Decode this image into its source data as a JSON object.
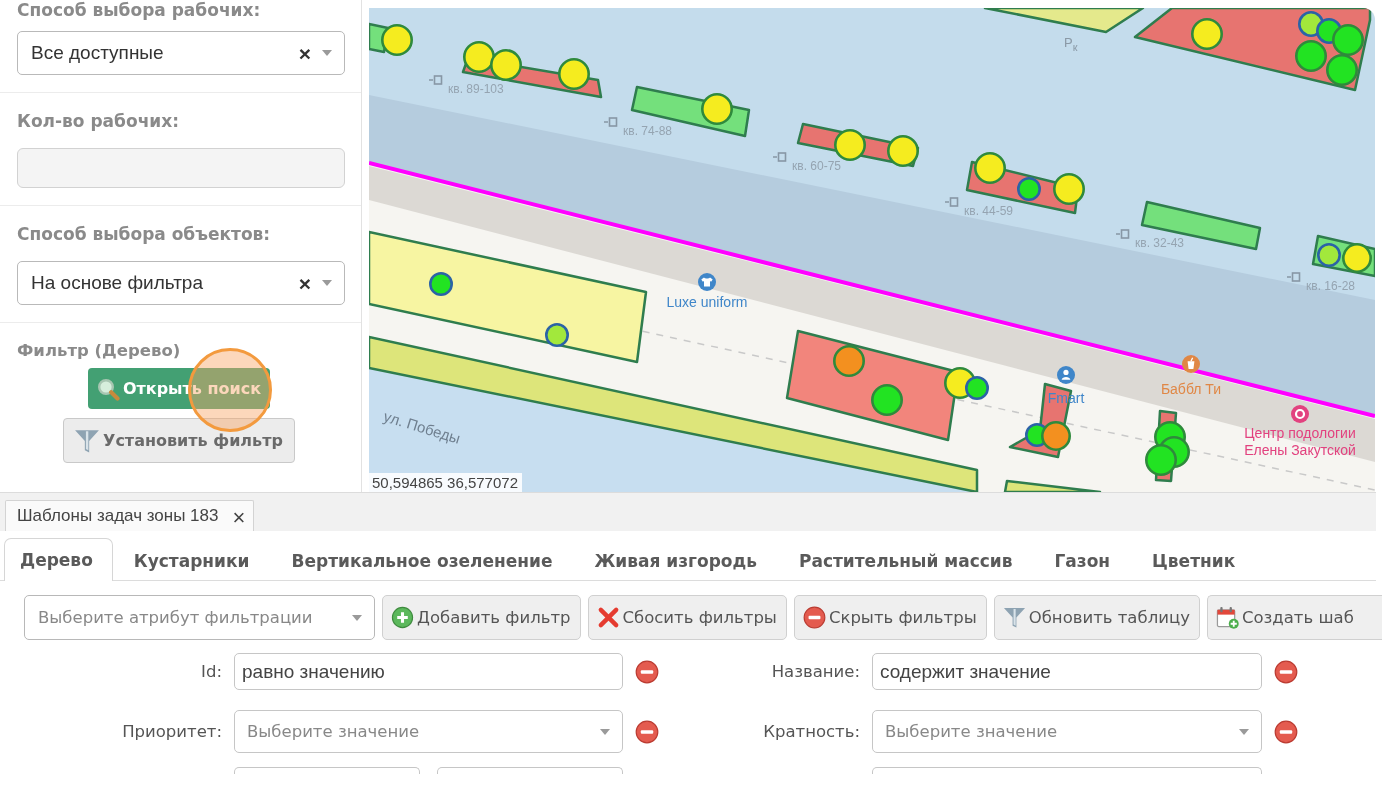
{
  "sidebar": {
    "sections": [
      {
        "label": "Способ выбора рабочих:",
        "kind": "select",
        "value": "Все доступные",
        "clear": "×"
      },
      {
        "label": "Кол-во рабочих:",
        "kind": "input"
      },
      {
        "label": "Способ выбора объектов:",
        "kind": "select",
        "value": "На основе фильтра",
        "clear": "×"
      },
      {
        "label": "Фильтр (Дерево)",
        "kind": "buttons",
        "buttons": [
          {
            "label": "Открыть поиск",
            "kind": "search"
          },
          {
            "label": "Установить фильтр",
            "kind": "filter"
          }
        ]
      }
    ]
  },
  "map": {
    "areas": [
      {
        "color": "#f7f5a2"
      },
      {
        "color": "#dde57a"
      },
      {
        "color": "#dde57a"
      },
      {
        "color": "#e4e98c"
      },
      {
        "color": "#74e07c"
      },
      {
        "color": "#e77470"
      },
      {
        "color": "#74e07c"
      },
      {
        "color": "#e77470"
      },
      {
        "color": "#e77470"
      },
      {
        "color": "#74e07c"
      },
      {
        "color": "#e77470"
      },
      {
        "color": "#74e07c"
      },
      {
        "color": "#f2857c"
      },
      {
        "color": "#e77470"
      },
      {
        "color": "#e77470"
      }
    ],
    "markers": [
      {
        "color": "#f5ec1f",
        "selected": false
      },
      {
        "color": "#f5ec1f",
        "selected": false
      },
      {
        "color": "#f5ec1f",
        "selected": false
      },
      {
        "color": "#f5ec1f",
        "selected": false
      },
      {
        "color": "#f5ec1f",
        "selected": false
      },
      {
        "color": "#f5ec1f",
        "selected": false
      },
      {
        "color": "#f5ec1f",
        "selected": false
      },
      {
        "color": "#f5ec1f",
        "selected": false
      },
      {
        "color": "#22e322",
        "selected": true
      },
      {
        "color": "#f5ec1f",
        "selected": false
      },
      {
        "color": "#f5ec1f",
        "selected": false
      },
      {
        "color": "#a2e83c",
        "selected": true
      },
      {
        "color": "#22e322",
        "selected": true
      },
      {
        "color": "#22e322",
        "selected": false
      },
      {
        "color": "#22e322",
        "selected": false
      },
      {
        "color": "#22e322",
        "selected": false
      },
      {
        "color": "#a2e83c",
        "selected": true
      },
      {
        "color": "#f5ec1f",
        "selected": false
      },
      {
        "color": "#22e322",
        "selected": true
      },
      {
        "color": "#a2e83c",
        "selected": true
      },
      {
        "color": "#f3901f",
        "selected": false
      },
      {
        "color": "#22e322",
        "selected": false
      },
      {
        "color": "#f5ec1f",
        "selected": false
      },
      {
        "color": "#22e322",
        "selected": true
      },
      {
        "color": "#22e322",
        "selected": true
      },
      {
        "color": "#f3901f",
        "selected": false
      },
      {
        "color": "#22e322",
        "selected": false
      },
      {
        "color": "#22e322",
        "selected": false
      },
      {
        "color": "#22e322",
        "selected": false
      }
    ],
    "labels": [
      {
        "kind": "house",
        "text": "кв. 89-103"
      },
      {
        "kind": "house",
        "text": "кв. 74-88"
      },
      {
        "kind": "house",
        "text": "кв. 60-75"
      },
      {
        "kind": "house",
        "text": "кв. 44-59"
      },
      {
        "kind": "house",
        "text": "кв. 32-43"
      },
      {
        "kind": "house",
        "text": "кв. 16-28"
      },
      {
        "kind": "parking",
        "text": "P$_{к}$"
      },
      {
        "kind": "poi",
        "text": "Luxe uniform",
        "color": "#3f86c9"
      },
      {
        "kind": "poi",
        "text": "Fmart",
        "color": "#3f86c9"
      },
      {
        "kind": "poi",
        "text": "Баббл Ти",
        "color": "#e08745"
      },
      {
        "kind": "poi",
        "text": "Центр подологии Елены Закутской",
        "color": "#e2427f"
      },
      {
        "kind": "street",
        "text": "ул. Победы"
      }
    ],
    "coordinates": "50,594865 36,577072"
  },
  "panel": {
    "tab": {
      "label": "Шаблоны задач зоны 183",
      "close": "×"
    },
    "tabs": [
      {
        "label": "Дерево",
        "selected": true
      },
      {
        "label": "Кустарники",
        "selected": false
      },
      {
        "label": "Вертикальное озеленение",
        "selected": false
      },
      {
        "label": "Живая изгородь",
        "selected": false
      },
      {
        "label": "Растительный массив",
        "selected": false
      },
      {
        "label": "Газон",
        "selected": false
      },
      {
        "label": "Цветник",
        "selected": false
      }
    ],
    "toolbar": {
      "attribute_select": {
        "placeholder": "Выберите атрибут фильтрации"
      },
      "buttons": [
        {
          "label": "Добавить фильтр",
          "kind": "add"
        },
        {
          "label": "Сбосить фильтры",
          "kind": "reset"
        },
        {
          "label": "Скрыть фильтры",
          "kind": "hide"
        },
        {
          "label": "Обновить таблицу",
          "kind": "refresh"
        },
        {
          "label": "Создать шаб",
          "kind": "create"
        }
      ]
    },
    "filters": [
      {
        "label": "Id:",
        "kind": "text",
        "value": "равно значению"
      },
      {
        "label": "Название:",
        "kind": "text",
        "value": "содержит значение"
      },
      {
        "label": "Приоритет:",
        "kind": "select",
        "placeholder": "Выберите значение"
      },
      {
        "label": "Кратность:",
        "kind": "select",
        "placeholder": "Выберите значение"
      },
      {
        "kind": "range"
      },
      {
        "kind": "text"
      }
    ]
  }
}
